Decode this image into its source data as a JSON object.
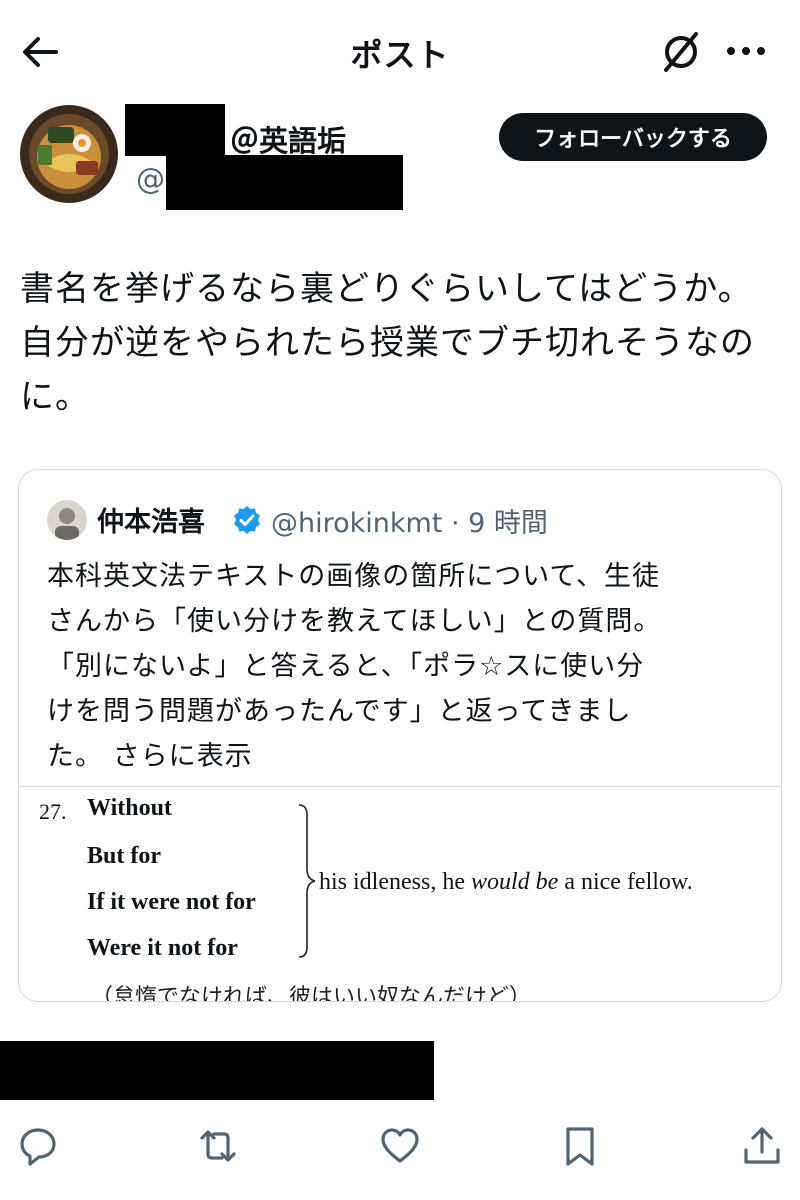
{
  "header": {
    "title": "ポスト",
    "back_icon": "arrow-left-icon",
    "grok_icon": "grok-icon",
    "more_icon": "more-dots-icon"
  },
  "author": {
    "display_name_suffix": "＠英語垢",
    "handle_prefix": "@",
    "follow_button": "フォローバックする"
  },
  "post": {
    "lines": [
      "書名を挙げるなら裏どりぐらいしてはどうか。",
      "自分が逆をやられたら授業でブチ切れそうなの",
      "に。"
    ]
  },
  "quote": {
    "name": "仲本浩喜",
    "handle_time": "@hirokinkmt · 9 時間",
    "lines": [
      "本科英文法テキストの画像の箇所について、生徒",
      "さんから「使い分けを教えてほしい」との質問。",
      "「別にないよ」と答えると、「ポラ☆スに使い分",
      "けを問う問題があったんです」と返ってきまし"
    ],
    "last_line": "た。",
    "show_more": "さらに表示",
    "image": {
      "number": "27.",
      "options": [
        "Without",
        "But for",
        "If it were not for",
        "Were it not for"
      ],
      "rest_plain": "his idleness, he ",
      "rest_italic": "would be",
      "rest_end": " a nice fellow.",
      "translation": "（怠惰でなければ、彼はいい奴なんだけど）"
    }
  },
  "actions": {
    "icons": [
      "reply-icon",
      "repost-icon",
      "like-icon",
      "bookmark-icon",
      "share-icon"
    ]
  },
  "colors": {
    "text": "#0f1419",
    "secondary": "#536471",
    "border": "#cfd9de",
    "verified": "#1d9bf0",
    "button_bg": "#0f1419"
  }
}
